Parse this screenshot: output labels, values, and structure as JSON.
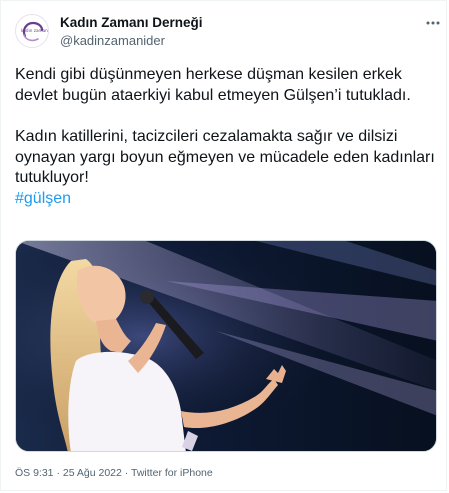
{
  "account": {
    "display_name": "Kadın Zamanı Derneği",
    "handle": "@kadinzamanider",
    "avatar_text": "kadın zamanı",
    "avatar_color": "#6a3d8f"
  },
  "tweet": {
    "paragraph_1": "Kendi gibi düşünmeyen herkese düşman kesilen erkek devlet bugün ataerkiyi kabul etmeyen Gülşen’i tutukladı.",
    "paragraph_2": "Kadın katillerini, tacizcileri cezalamakta sağır ve dilsizi oynayan yargı boyun eğmeyen ve mücadele eden kadınları tutukluyor!",
    "hashtag": "#gülşen",
    "hashtag_color": "#1d9bf0"
  },
  "more_icon": "more-horizontal-icon",
  "metadata": {
    "time": "ÖS 9:31",
    "separator_1": "·",
    "date": "25 Ağu 2022",
    "separator_2": "·",
    "source": "Twitter for iPhone"
  }
}
